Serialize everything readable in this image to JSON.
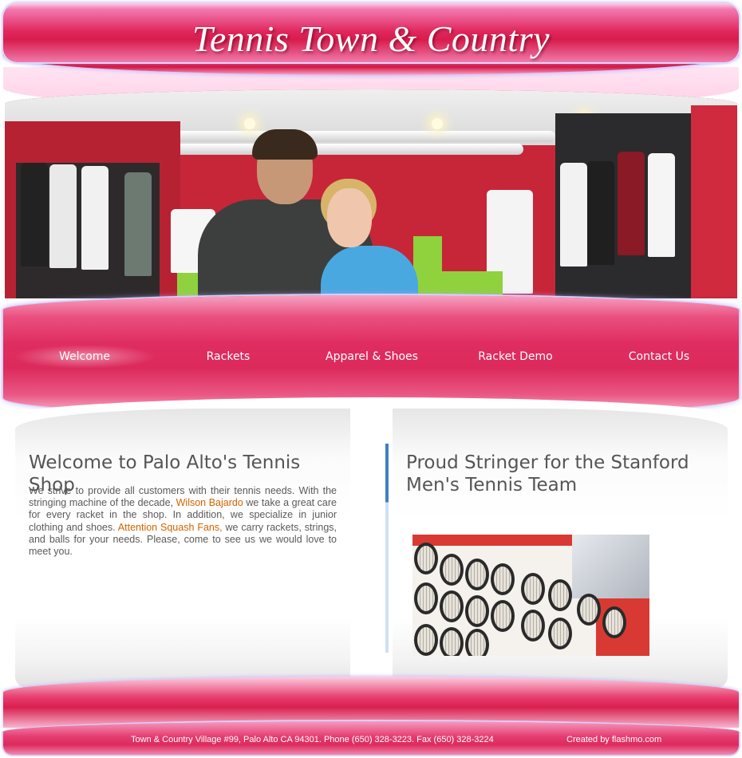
{
  "header": {
    "title": "Tennis Town & Country"
  },
  "nav": {
    "items": [
      {
        "label": "Welcome",
        "active": true
      },
      {
        "label": "Rackets",
        "active": false
      },
      {
        "label": "Apparel & Shoes",
        "active": false
      },
      {
        "label": "Racket Demo",
        "active": false
      },
      {
        "label": "Contact Us",
        "active": false
      }
    ]
  },
  "welcome": {
    "heading": "Welcome to Palo Alto's Tennis Shop",
    "text_1": "We strive to provide all customers with their tennis needs. With the stringing machine of the decade, ",
    "link_1": "Wilson Bajardo",
    "text_2": " we take a great care for every racket in the shop. In addition, we specialize in junior clothing and shoes. ",
    "link_2": "Attention Squash Fans,",
    "text_3": " we carry rackets, strings, and balls for your needs. Please, come to see us we would love to meet you."
  },
  "stringer": {
    "heading": "Proud Stringer for the Stanford Men's Tennis Team"
  },
  "footer": {
    "address": "Town & Country Village #99, Palo Alto CA 94301. Phone (650) 328-3223. Fax (650) 328-3224",
    "credit": "Created by flashmo.com"
  },
  "colors": {
    "accent_pink": "#dc2a5c",
    "link_orange": "#d26400",
    "divider_blue": "#3f7fc7"
  }
}
